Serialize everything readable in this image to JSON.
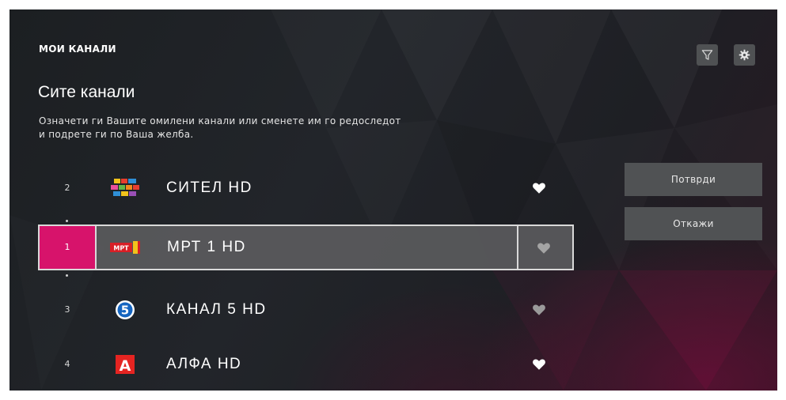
{
  "header": {
    "section_label": "МОИ КАНАЛИ",
    "title": "Сите канали",
    "description_line1": "Означети ги Вашите омилени канали или сменете им го редоследот",
    "description_line2": "и подрете ги по Ваша желба."
  },
  "toolbar": {
    "filter_icon": "filter-icon",
    "settings_icon": "gear-icon"
  },
  "channels": [
    {
      "number": "2",
      "name": "СИТЕЛ HD",
      "logo": "sitel-logo",
      "favorite": true
    },
    {
      "number": "1",
      "name": "МРТ 1 HD",
      "logo": "mrt-logo",
      "logo_text": "МРТ",
      "favorite": false,
      "selected": true
    },
    {
      "number": "3",
      "name": "КАНАЛ 5 HD",
      "logo": "kanal5-logo",
      "logo_text": "5",
      "favorite": false
    },
    {
      "number": "4",
      "name": "АЛФА HD",
      "logo": "alfa-logo",
      "logo_text": "А",
      "favorite": true
    }
  ],
  "actions": {
    "confirm": "Потврди",
    "cancel": "Откажи"
  },
  "colors": {
    "accent": "#d7136b",
    "button_bg": "#505254",
    "heart_on": "#ffffff",
    "heart_off": "#9a9a9a"
  }
}
